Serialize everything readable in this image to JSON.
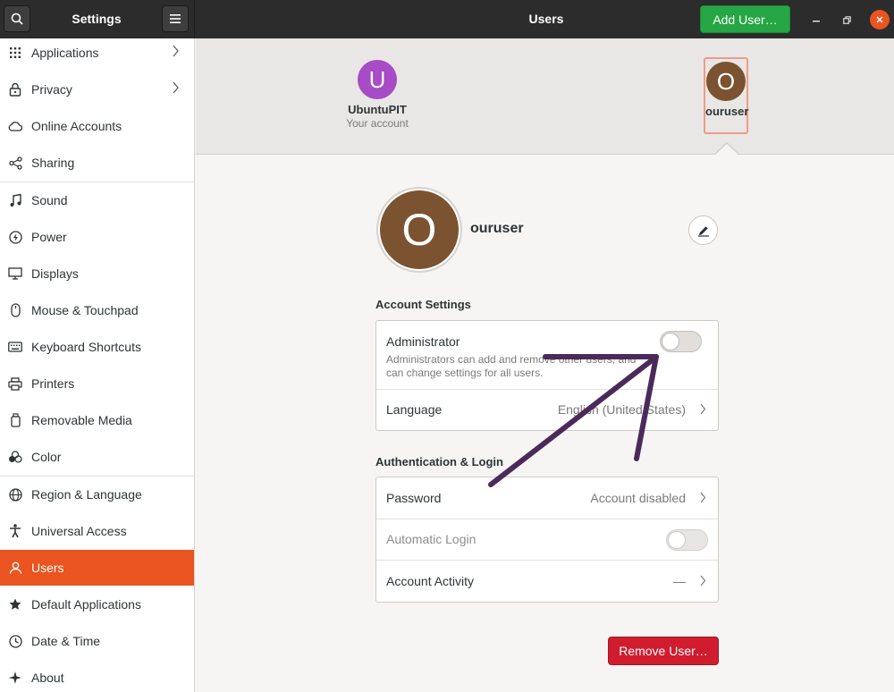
{
  "header": {
    "left_title": "Settings",
    "title": "Users",
    "add_user_label": "Add User…"
  },
  "sidebar": {
    "items": [
      {
        "label": "Applications",
        "icon": "grid-icon",
        "chevron": true
      },
      {
        "label": "Privacy",
        "icon": "lock-icon",
        "chevron": true
      },
      {
        "label": "Online Accounts",
        "icon": "cloud-icon"
      },
      {
        "label": "Sharing",
        "icon": "share-icon"
      },
      {
        "label": "Sound",
        "icon": "music-note-icon"
      },
      {
        "label": "Power",
        "icon": "power-icon"
      },
      {
        "label": "Displays",
        "icon": "display-icon"
      },
      {
        "label": "Mouse & Touchpad",
        "icon": "mouse-icon"
      },
      {
        "label": "Keyboard Shortcuts",
        "icon": "keyboard-icon"
      },
      {
        "label": "Printers",
        "icon": "printer-icon"
      },
      {
        "label": "Removable Media",
        "icon": "usb-icon"
      },
      {
        "label": "Color",
        "icon": "color-icon"
      },
      {
        "label": "Region & Language",
        "icon": "globe-icon"
      },
      {
        "label": "Universal Access",
        "icon": "accessibility-icon"
      },
      {
        "label": "Users",
        "icon": "user-icon",
        "active": true
      },
      {
        "label": "Default Applications",
        "icon": "star-icon"
      },
      {
        "label": "Date & Time",
        "icon": "clock-icon"
      },
      {
        "label": "About",
        "icon": "sparkle-icon"
      }
    ]
  },
  "carousel": {
    "users": [
      {
        "initial": "U",
        "name": "UbuntuPIT",
        "subtitle": "Your account",
        "color": "#a84bc6"
      },
      {
        "initial": "O",
        "name": "ouruser",
        "color": "#7b5330",
        "selected": true
      }
    ]
  },
  "profile": {
    "initial": "O",
    "name": "ouruser"
  },
  "account_settings": {
    "title": "Account Settings",
    "administrator": {
      "label": "Administrator",
      "description": "Administrators can add and remove other users, and can change settings for all users.",
      "enabled": false
    },
    "language": {
      "label": "Language",
      "value": "English (United States)"
    }
  },
  "auth": {
    "title": "Authentication & Login",
    "password": {
      "label": "Password",
      "value": "Account disabled"
    },
    "automatic_login": {
      "label": "Automatic Login",
      "enabled": false
    },
    "account_activity": {
      "label": "Account Activity",
      "value": "—"
    }
  },
  "remove_user_label": "Remove User…",
  "colors": {
    "accent": "#e95420",
    "add_button": "#26a644",
    "remove_button": "#d01c2e",
    "annotation_arrow": "#4b2a5a"
  }
}
